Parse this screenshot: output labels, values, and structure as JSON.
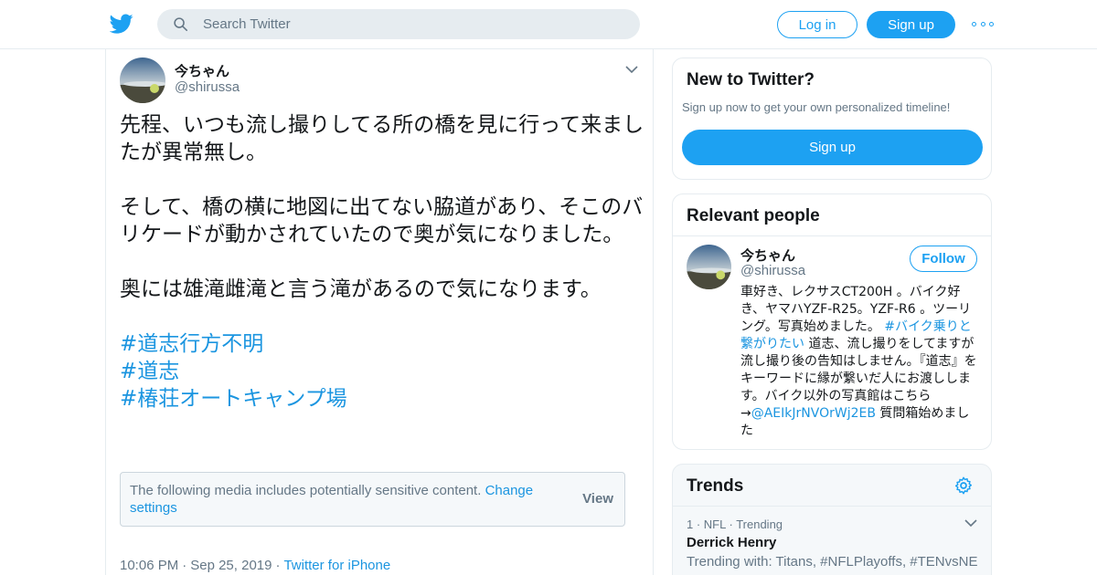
{
  "header": {
    "search_placeholder": "Search Twitter",
    "login_label": "Log in",
    "signup_label": "Sign up",
    "icons": [
      "twitter-bird-icon",
      "search-icon",
      "more-dots-icon"
    ]
  },
  "tweet": {
    "author_name": "今ちゃん",
    "author_handle": "@shirussa",
    "paragraphs": [
      "先程、いつも流し撮りしてる所の橋を見に行って来ましたが異常無し。",
      "そして、橋の横に地図に出てない脇道があり、そこのバリケードが動かされていたので奥が気になりました。",
      "奥には雄滝雌滝と言う滝があるので気になります。"
    ],
    "hashtags": [
      "#道志行方不明",
      "#道志",
      "#椿荘オートキャンプ場"
    ],
    "sensitive_message": "The following media includes potentially sensitive content.",
    "sensitive_link": "Change settings",
    "sensitive_view": "View",
    "time": "10:06 PM",
    "date": "Sep 25, 2019",
    "source": "Twitter for iPhone"
  },
  "sidebar": {
    "new_to_twitter": {
      "title": "New to Twitter?",
      "subtitle": "Sign up now to get your own personalized timeline!",
      "button": "Sign up"
    },
    "relevant_people": {
      "title": "Relevant people",
      "name": "今ちゃん",
      "handle": "@shirussa",
      "follow_label": "Follow",
      "bio_part1": "車好き、レクサスCT200H 。バイク好き、ヤマハYZF-R25。YZF-R6 。ツーリング。写真始めました。 ",
      "bio_link1": "#バイク乗りと繋がりたい",
      "bio_part2": " 道志、流し撮りをしてますが流し撮り後の告知はしません。『道志』をキーワードに縁が繋いだ人にお渡しします。バイク以外の写真館はこちら→",
      "bio_link2": "@AEIkJrNVOrWj2EB",
      "bio_part3": " 質問箱始めました"
    },
    "trends": {
      "title": "Trends",
      "item": {
        "rank": "1",
        "category": "NFL",
        "status": "Trending",
        "name": "Derrick Henry",
        "trending_with": "Trending with: Titans, #NFLPlayoffs, #TENvsNE"
      }
    }
  },
  "colors": {
    "brand_blue": "#1da1f2",
    "link_blue": "#1b95e0",
    "secondary_text": "#657786",
    "border": "#e6ecf0"
  }
}
